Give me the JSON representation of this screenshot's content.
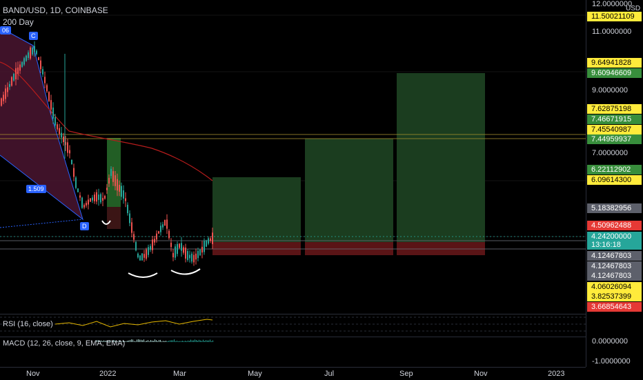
{
  "header": {
    "symbol_title": "BAND/USD, 1D, COINBASE",
    "indicator_label": "200 Day"
  },
  "indicators": {
    "rsi_label": "RSI (16, close)",
    "macd_label": "MACD (12, 26, close, 9, EMA, EMA)"
  },
  "price_axis": {
    "currency": "USD",
    "tick_labels": [
      "12.0000000",
      "11.0000000",
      "9.0000000",
      "7.0000000"
    ],
    "macd_tick_labels": [
      "0.0000000",
      "-1.0000000"
    ]
  },
  "price_tags": [
    {
      "value": "11.50021109",
      "style": "yellow"
    },
    {
      "value": "9.64941828",
      "style": "yellow"
    },
    {
      "value": "9.60946609",
      "style": "green"
    },
    {
      "value": "7.62875198",
      "style": "yellow"
    },
    {
      "value": "7.46671915",
      "style": "green"
    },
    {
      "value": "7.45540987",
      "style": "yellow"
    },
    {
      "value": "7.44959937",
      "style": "green"
    },
    {
      "value": "6.22112902",
      "style": "green"
    },
    {
      "value": "6.09614300",
      "style": "yellow"
    },
    {
      "value": "5.18382956",
      "style": "gray"
    },
    {
      "value": "4.50962488",
      "style": "red"
    },
    {
      "value": "4.24200000",
      "style": "teal"
    },
    {
      "value": "13:16:18",
      "style": "teal"
    },
    {
      "value": "4.12467803",
      "style": "gray"
    },
    {
      "value": "4.12467803",
      "style": "gray"
    },
    {
      "value": "4.12467803",
      "style": "gray"
    },
    {
      "value": "4.06026094",
      "style": "yellow"
    },
    {
      "value": "3.82537399",
      "style": "yellow"
    },
    {
      "value": "3.66854643",
      "style": "red"
    }
  ],
  "time_axis": {
    "labels": [
      "Nov",
      "2022",
      "Mar",
      "May",
      "Jul",
      "Sep",
      "Nov",
      "2023"
    ]
  },
  "pattern_labels": {
    "top_left": "06",
    "point_c": "C",
    "point_d": "D",
    "ratio": "1.509"
  },
  "colors": {
    "background": "#000000",
    "candle_up": "#26a69a",
    "candle_down": "#ef5350",
    "tag_yellow": "#ffeb3b",
    "tag_green": "#388e3c",
    "tag_red": "#e53935",
    "tag_teal": "#26a69a",
    "tag_gray": "#5d606b",
    "target_zone": "#1b3d1f",
    "stop_zone": "#5a1416",
    "pattern_fill": "#4a1530",
    "ma_line": "#b71c1c"
  }
}
